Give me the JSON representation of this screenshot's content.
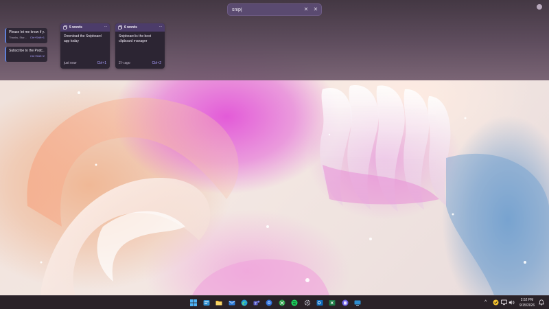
{
  "search": {
    "value": "snip|",
    "placeholder": ""
  },
  "side_items": [
    {
      "title": "Please let me know if y...",
      "subtitle": "Thanks, Star...",
      "shortcut": "Ctrl+Shift+1"
    },
    {
      "title": "Subscribe to the Podc...",
      "subtitle": "",
      "shortcut": "Ctrl+Shift+2"
    }
  ],
  "cards": [
    {
      "words": "5 words",
      "text": "Download the Snipboard app today",
      "time": "just now",
      "shortcut": "Ctrl+1"
    },
    {
      "words": "6 words",
      "text": "Snipboard is the best clipboard manager",
      "time": "2 h ago",
      "shortcut": "Ctrl+2"
    }
  ],
  "taskbar": {
    "apps": [
      "windows-start-icon",
      "widgets-icon",
      "file-explorer-icon",
      "mail-icon",
      "edge-icon",
      "teams-icon",
      "chrome-icon",
      "xbox-icon",
      "spotify-icon",
      "settings-icon",
      "outlook-icon",
      "excel-icon",
      "snipboard-icon",
      "remote-desktop-icon"
    ],
    "time": "2:52 PM",
    "date": "9/15/2026"
  },
  "colors": {
    "accent": "#a99fff",
    "card_header": "#4c3c6a",
    "taskbar": "#2a2228"
  }
}
